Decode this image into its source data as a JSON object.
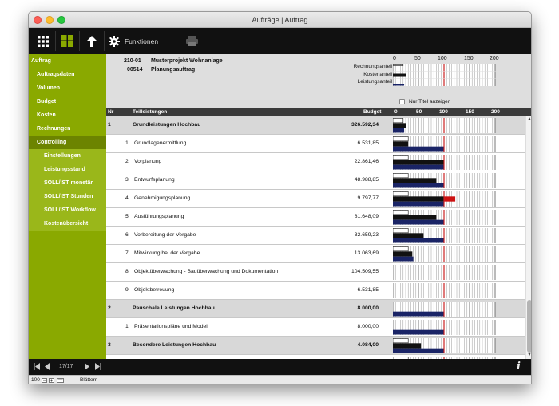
{
  "window": {
    "title": "Aufträge | Auftrag"
  },
  "toolbar": {
    "grid_icon": "grid-icon",
    "layout_icon": "layout-icon",
    "up_icon": "arrow-up-icon",
    "functions_label": "Funktionen",
    "print_icon": "printer-icon"
  },
  "sidebar": {
    "items": [
      {
        "label": "Auftrag",
        "type": "header"
      },
      {
        "label": "Auftragsdaten",
        "type": "item"
      },
      {
        "label": "Volumen",
        "type": "item"
      },
      {
        "label": "Budget",
        "type": "item"
      },
      {
        "label": "Kosten",
        "type": "item"
      },
      {
        "label": "Rechnungen",
        "type": "item"
      },
      {
        "label": "Controlling",
        "type": "active"
      }
    ],
    "subitems": [
      {
        "label": "Einstellungen"
      },
      {
        "label": "Leistungsstand"
      },
      {
        "label": "SOLL/IST monetär"
      },
      {
        "label": "SOLL/IST Stunden"
      },
      {
        "label": "SOLL/IST Workflow"
      },
      {
        "label": "Kostenübersicht"
      }
    ]
  },
  "project": {
    "number": "210-01",
    "name": "Musterprojekt Wohnanlage",
    "order_number": "00514",
    "order_name": "Planungsauftrag"
  },
  "scale": {
    "ticks": [
      "0",
      "50",
      "100",
      "150",
      "200"
    ],
    "max": 200
  },
  "legend": {
    "invoice_label": "Rechnungsanteil",
    "cost_label": "Kostenanteil",
    "performance_label": "Leistungsanteil",
    "invoice_pct": 20,
    "cost_pct": 25,
    "performance_pct": 22
  },
  "filter": {
    "titles_only_label": "Nur Titel anzeigen"
  },
  "columns": {
    "nr": "Nr",
    "title": "Teilleistungen",
    "budget": "Budget",
    "scale_ticks": [
      "0",
      "50",
      "100",
      "150",
      "200"
    ]
  },
  "rows": [
    {
      "nr": "1",
      "title": "Grundleistungen Hochbau",
      "budget": "326.592,34",
      "bold": true,
      "invoice": 20,
      "cost": 25,
      "performance": 22
    },
    {
      "nr": "1",
      "title": "Grundlagenermittlung",
      "budget": "6.531,85",
      "bold": false,
      "invoice": 30,
      "cost": 30,
      "performance": 100
    },
    {
      "nr": "2",
      "title": "Vorplanung",
      "budget": "22.861,46",
      "bold": false,
      "invoice": 30,
      "cost": 100,
      "performance": 100
    },
    {
      "nr": "3",
      "title": "Entwurfsplanung",
      "budget": "48.988,85",
      "bold": false,
      "invoice": 30,
      "cost": 85,
      "performance": 100
    },
    {
      "nr": "4",
      "title": "Genehmigungsplanung",
      "budget": "9.797,77",
      "bold": false,
      "invoice": 30,
      "cost": 122,
      "performance": 100
    },
    {
      "nr": "5",
      "title": "Ausführungsplanung",
      "budget": "81.648,09",
      "bold": false,
      "invoice": 30,
      "cost": 85,
      "performance": 100
    },
    {
      "nr": "6",
      "title": "Vorbereitung der Vergabe",
      "budget": "32.659,23",
      "bold": false,
      "invoice": 30,
      "cost": 60,
      "performance": 100
    },
    {
      "nr": "7",
      "title": "Mitwirkung bei der Vergabe",
      "budget": "13.063,69",
      "bold": false,
      "invoice": 30,
      "cost": 38,
      "performance": 40
    },
    {
      "nr": "8",
      "title": "Objektüberwachung - Bauüberwachung und Dokumentation",
      "budget": "104.509,55",
      "bold": false,
      "invoice": 0,
      "cost": 0,
      "performance": 0
    },
    {
      "nr": "9",
      "title": "Objektbetreuung",
      "budget": "6.531,85",
      "bold": false,
      "invoice": 0,
      "cost": 0,
      "performance": 0
    },
    {
      "nr": "2",
      "title": "Pauschale Leistungen Hochbau",
      "budget": "8.000,00",
      "bold": true,
      "invoice": 0,
      "cost": 0,
      "performance": 100
    },
    {
      "nr": "1",
      "title": "Präsentationspläne und Modell",
      "budget": "8.000,00",
      "bold": false,
      "invoice": 0,
      "cost": 0,
      "performance": 100
    },
    {
      "nr": "3",
      "title": "Besondere Leistungen Hochbau",
      "budget": "4.084,00",
      "bold": true,
      "invoice": 30,
      "cost": 55,
      "performance": 100
    },
    {
      "nr": "1",
      "title": "Bestandsaufnahme",
      "budget": "4.084,00",
      "bold": false,
      "invoice": 30,
      "cost": 55,
      "performance": 100
    }
  ],
  "navigation": {
    "record_position": "17/17",
    "info_icon": "info-icon"
  },
  "footer": {
    "zoom": "100",
    "mode": "Blättern"
  },
  "colors": {
    "sidebar": "#8aa900",
    "sidebar_active": "#6c8400",
    "sidebar_sub": "#9ab71a",
    "cost_bar": "#111111",
    "overrun_bar": "#cc1111",
    "performance_bar": "#1a2466",
    "target_line": "#cc2222"
  }
}
